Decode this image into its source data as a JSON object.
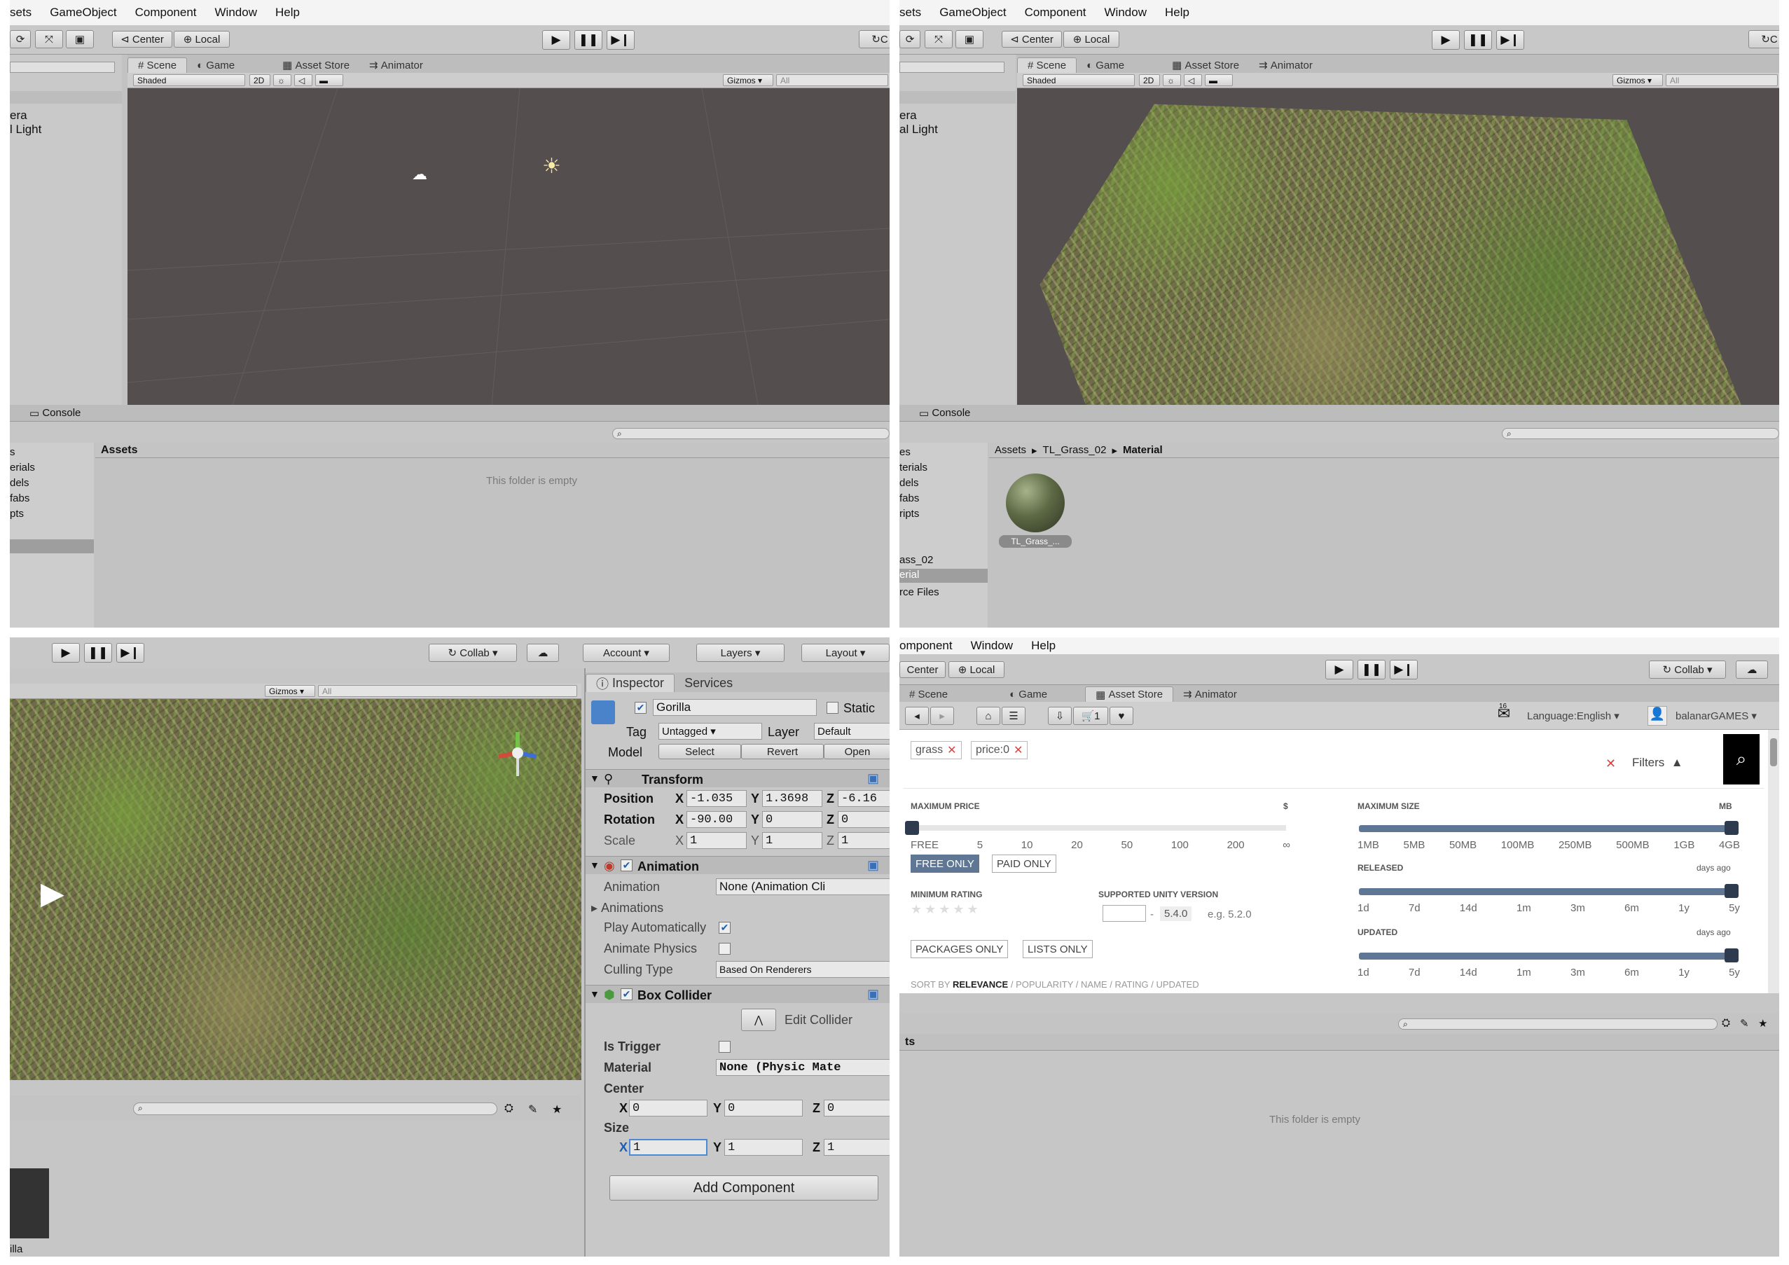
{
  "q1": {
    "menu": [
      "sets",
      "GameObject",
      "Component",
      "Window",
      "Help"
    ],
    "center": "Center",
    "local": "Local",
    "tabs": [
      "Scene",
      "Game",
      "Asset Store",
      "Animator"
    ],
    "shaded": "Shaded",
    "twoD": "2D",
    "gizmos": "Gizmos",
    "all": "All",
    "hier": [
      "era",
      "l Light"
    ],
    "console": "Console",
    "proj_left": [
      "s",
      "erials",
      "dels",
      "fabs",
      "pts"
    ],
    "assets_hdr": "Assets",
    "empty": "This folder is empty"
  },
  "q2": {
    "menu": [
      "sets",
      "GameObject",
      "Component",
      "Window",
      "Help"
    ],
    "center": "Center",
    "local": "Local",
    "tabs": [
      "Scene",
      "Game",
      "Asset Store",
      "Animator"
    ],
    "shaded": "Shaded",
    "twoD": "2D",
    "gizmos": "Gizmos",
    "all": "All",
    "hier": [
      "era",
      "al Light"
    ],
    "console": "Console",
    "proj_left": [
      "es",
      "terials",
      "dels",
      "fabs",
      "ripts",
      "ass_02",
      "erial",
      "rce Files"
    ],
    "breadcrumb": [
      "Assets",
      "TL_Grass_02",
      "Material"
    ],
    "asset_label": "TL_Grass_..."
  },
  "q3": {
    "collab": "Collab",
    "account": "Account",
    "layers": "Layers",
    "layout": "Layout",
    "gizmos": "Gizmos",
    "all": "All",
    "tabs": [
      "Inspector",
      "Services"
    ],
    "object_name": "Gorilla",
    "static": "Static",
    "tag_label": "Tag",
    "tag": "Untagged",
    "layer_label": "Layer",
    "layer": "Default",
    "model_label": "Model",
    "select": "Select",
    "revert": "Revert",
    "open": "Open",
    "transform": "Transform",
    "position": "Position",
    "pos": [
      "-1.035",
      "1.3698",
      "-6.16"
    ],
    "rotation": "Rotation",
    "rot": [
      "-90.00",
      "0",
      "0"
    ],
    "scale": "Scale",
    "scl": [
      "1",
      "1",
      "1"
    ],
    "animation_comp": "Animation",
    "animation_label": "Animation",
    "animation_val": "None (Animation Cli",
    "animations": "Animations",
    "play_auto": "Play Automatically",
    "anim_physics": "Animate Physics",
    "culling": "Culling Type",
    "culling_val": "Based On Renderers",
    "box_collider": "Box Collider",
    "edit_collider": "Edit Collider",
    "is_trigger": "Is Trigger",
    "material": "Material",
    "material_val": "None (Physic Mate",
    "center": "Center",
    "ctr": [
      "0",
      "0",
      "0"
    ],
    "size": "Size",
    "sz": [
      "1",
      "1",
      "1"
    ],
    "add_component": "Add Component",
    "asset_label": "illa"
  },
  "q4": {
    "menu": [
      "omponent",
      "Window",
      "Help"
    ],
    "center": "Center",
    "local": "Local",
    "collab": "Collab",
    "tabs": [
      "Scene",
      "Game",
      "Asset Store",
      "Animator"
    ],
    "cart_count": "1",
    "mail_count": "16",
    "language": "Language:English",
    "user": "balanarGAMES",
    "chips": [
      "grass",
      "price:0"
    ],
    "filters": "Filters",
    "max_price": "MAXIMUM PRICE",
    "dollar": "$",
    "price_ticks": [
      "FREE",
      "5",
      "10",
      "20",
      "50",
      "100",
      "200",
      "∞"
    ],
    "free_only": "FREE ONLY",
    "paid_only": "PAID ONLY",
    "min_rating": "MINIMUM RATING",
    "unity_ver": "SUPPORTED UNITY VERSION",
    "ver_val": "5.4.0",
    "ver_eg": "e.g. 5.2.0",
    "packages_only": "PACKAGES ONLY",
    "lists_only": "LISTS ONLY",
    "max_size": "MAXIMUM SIZE",
    "mb": "MB",
    "size_ticks": [
      "1MB",
      "5MB",
      "50MB",
      "100MB",
      "250MB",
      "500MB",
      "1GB",
      "4GB"
    ],
    "released": "RELEASED",
    "days_ago": "days ago",
    "updated": "UPDATED",
    "time_ticks": [
      "1d",
      "7d",
      "14d",
      "1m",
      "3m",
      "6m",
      "1y",
      "5y"
    ],
    "sort_label": "SORT BY",
    "sort_opts": [
      "RELEVANCE",
      "POPULARITY",
      "NAME",
      "RATING",
      "UPDATED"
    ],
    "proj_hdr": "ts",
    "empty": "This folder is empty"
  }
}
